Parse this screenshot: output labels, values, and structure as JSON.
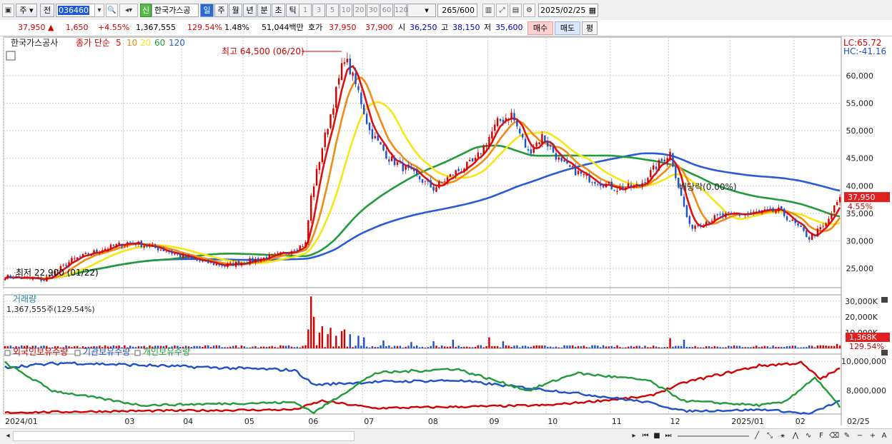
{
  "toolbar": {
    "type_label": "주",
    "prev_label": "전",
    "code": "036460",
    "new_badge": "신",
    "stock_name": "한국가스공",
    "period_tabs": [
      "일",
      "주",
      "월",
      "년",
      "분",
      "초",
      "틱"
    ],
    "minute_steps": [
      "1",
      "3",
      "5",
      "10",
      "20",
      "30",
      "60",
      "120"
    ],
    "count": "265",
    "count_total": "/600",
    "date": "2025/02/25"
  },
  "quote": {
    "price": "37,950",
    "change": "1,650",
    "change_pct": "+4.55%",
    "volume": "1,367,555",
    "volume_ratio": "129.54%",
    "turnover_ratio": "1.48%",
    "amount": "51,044백만",
    "ask_label": "호가",
    "ask": "37,950",
    "bid": "37,900",
    "open_label": "시",
    "open": "36,250",
    "high_label": "고",
    "high": "38,150",
    "low_label": "저",
    "low": "35,600",
    "buy_button": "매수",
    "sell_button": "매도",
    "eval_button": "평"
  },
  "chart_data": {
    "type": "candlestick",
    "stock": "한국가스공사",
    "price_legend": "종가 단순",
    "ma_periods": [
      "5",
      "10",
      "20",
      "60",
      "120"
    ],
    "colors": {
      "up": "#d20000",
      "down": "#1e50c8",
      "ma5": "#e01010",
      "ma10": "#ef8c14",
      "ma20": "#f5e614",
      "ma60": "#229a3c",
      "ma120": "#2a5ad8",
      "volume_up": "#d20000",
      "volume_down": "#1e50c8"
    },
    "y_ticks": [
      "60,000",
      "55,000",
      "50,000",
      "45,000",
      "40,000",
      "35,000",
      "30,000",
      "25,000"
    ],
    "y_tick_values": [
      60000,
      55000,
      50000,
      45000,
      40000,
      35000,
      30000,
      25000
    ],
    "ylim": [
      21500,
      67000
    ],
    "x_ticks": [
      "2024/01",
      "03",
      "04",
      "05",
      "06",
      "07",
      "08",
      "09",
      "10",
      "11",
      "12",
      "2025/01",
      "02",
      "02/25"
    ],
    "max_label": "최고 64,500 (06/20)",
    "min_label": "최저 22,900 (01/22)",
    "dividend_label": "배당락(0.00%)",
    "lc_label": "LC:65.72",
    "hc_label": "HC:-41.16",
    "last_price_label": "37,950",
    "last_pct_label": "4.55%",
    "anchors": [
      [
        "2024-01-02",
        23500
      ],
      [
        "2024-01-22",
        22900
      ],
      [
        "2024-02-05",
        26500
      ],
      [
        "2024-02-20",
        28500
      ],
      [
        "2024-03-05",
        29800
      ],
      [
        "2024-03-20",
        28500
      ],
      [
        "2024-04-05",
        26500
      ],
      [
        "2024-04-20",
        25500
      ],
      [
        "2024-05-05",
        26500
      ],
      [
        "2024-05-20",
        27500
      ],
      [
        "2024-05-31",
        29500
      ],
      [
        "2024-06-04",
        38000
      ],
      [
        "2024-06-10",
        47000
      ],
      [
        "2024-06-14",
        55000
      ],
      [
        "2024-06-20",
        63500
      ],
      [
        "2024-06-27",
        57000
      ],
      [
        "2024-07-03",
        50000
      ],
      [
        "2024-07-12",
        45000
      ],
      [
        "2024-07-25",
        42000
      ],
      [
        "2024-08-05",
        39500
      ],
      [
        "2024-08-15",
        42500
      ],
      [
        "2024-08-26",
        44500
      ],
      [
        "2024-09-05",
        51500
      ],
      [
        "2024-09-12",
        53000
      ],
      [
        "2024-09-20",
        46000
      ],
      [
        "2024-09-27",
        49000
      ],
      [
        "2024-10-08",
        44000
      ],
      [
        "2024-10-20",
        41500
      ],
      [
        "2024-11-05",
        39500
      ],
      [
        "2024-11-15",
        40000
      ],
      [
        "2024-11-22",
        43000
      ],
      [
        "2024-12-02",
        46000
      ],
      [
        "2024-12-06",
        38000
      ],
      [
        "2024-12-11",
        32500
      ],
      [
        "2024-12-26",
        34500
      ],
      [
        "2025-01-10",
        35000
      ],
      [
        "2025-01-24",
        35500
      ],
      [
        "2025-02-03",
        33000
      ],
      [
        "2025-02-10",
        30500
      ],
      [
        "2025-02-18",
        33000
      ],
      [
        "2025-02-25",
        37950
      ]
    ],
    "volume_legend": "거래량",
    "volume_value": "1,367,555주(129.54%)",
    "volume_ticks": [
      "30,000K",
      "20,000K",
      "10,000K"
    ],
    "volume_tick_values": [
      30000,
      20000,
      10000
    ],
    "volume_max": 34000,
    "volume_last_label": "1,368K",
    "volume_last_pct": "129.54%",
    "volume_spikes": [
      [
        "2024-06-03",
        12000
      ],
      [
        "2024-06-04",
        33000
      ],
      [
        "2024-06-05",
        20000
      ],
      [
        "2024-06-07",
        10000
      ],
      [
        "2024-06-10",
        14000
      ],
      [
        "2024-06-12",
        9000
      ],
      [
        "2024-06-13",
        13000
      ],
      [
        "2024-06-17",
        8000
      ],
      [
        "2024-06-19",
        11000
      ],
      [
        "2024-06-20",
        12000
      ],
      [
        "2024-06-24",
        9000
      ],
      [
        "2024-06-27",
        8000
      ],
      [
        "2024-07-01",
        7000
      ],
      [
        "2024-07-10",
        5000
      ],
      [
        "2024-07-24",
        4000
      ],
      [
        "2024-08-05",
        4500
      ],
      [
        "2024-08-14",
        5500
      ],
      [
        "2024-09-02",
        7000
      ],
      [
        "2024-09-09",
        4500
      ],
      [
        "2024-12-02",
        6500
      ],
      [
        "2024-12-09",
        5500
      ],
      [
        "2025-02-24",
        2800
      ]
    ],
    "holding_legend": [
      "외국인보유수량",
      "기관보유수량",
      "개인보유수량"
    ],
    "holding_colors": [
      "#d20000",
      "#1e50c8",
      "#229a3c"
    ],
    "holding_ticks": [
      "10,000,000",
      "8,000,000"
    ],
    "holding_tick_values": [
      10000000,
      8000000
    ],
    "holding_range": [
      6400000,
      10500000
    ],
    "foreign_anchors": [
      [
        "2024-01-02",
        6500000
      ],
      [
        "2024-03-01",
        6600000
      ],
      [
        "2024-05-25",
        6700000
      ],
      [
        "2024-06-10",
        7300000
      ],
      [
        "2024-07-05",
        6800000
      ],
      [
        "2024-08-20",
        6900000
      ],
      [
        "2024-10-01",
        7000000
      ],
      [
        "2024-11-20",
        7600000
      ],
      [
        "2024-12-10",
        8600000
      ],
      [
        "2025-01-15",
        9700000
      ],
      [
        "2025-02-05",
        9900000
      ],
      [
        "2025-02-14",
        8800000
      ],
      [
        "2025-02-25",
        9500000
      ]
    ],
    "institution_anchors": [
      [
        "2024-01-02",
        9600000
      ],
      [
        "2024-02-01",
        9900000
      ],
      [
        "2024-05-25",
        9400000
      ],
      [
        "2024-06-05",
        8400000
      ],
      [
        "2024-07-05",
        8600000
      ],
      [
        "2024-08-15",
        8700000
      ],
      [
        "2024-10-10",
        7900000
      ],
      [
        "2024-11-20",
        7200000
      ],
      [
        "2024-12-09",
        6600000
      ],
      [
        "2025-01-20",
        6700000
      ],
      [
        "2025-02-10",
        6400000
      ],
      [
        "2025-02-25",
        7300000
      ]
    ],
    "individual_anchors": [
      [
        "2024-01-02",
        9900000
      ],
      [
        "2024-01-25",
        8000000
      ],
      [
        "2024-03-10",
        7000000
      ],
      [
        "2024-05-25",
        7200000
      ],
      [
        "2024-06-05",
        6500000
      ],
      [
        "2024-07-05",
        9200000
      ],
      [
        "2024-08-15",
        9500000
      ],
      [
        "2024-09-20",
        8000000
      ],
      [
        "2024-10-15",
        9200000
      ],
      [
        "2024-11-20",
        8700000
      ],
      [
        "2024-12-09",
        7300000
      ],
      [
        "2025-01-15",
        7000000
      ],
      [
        "2025-01-28",
        7200000
      ],
      [
        "2025-02-12",
        8900000
      ],
      [
        "2025-02-25",
        6900000
      ]
    ]
  }
}
